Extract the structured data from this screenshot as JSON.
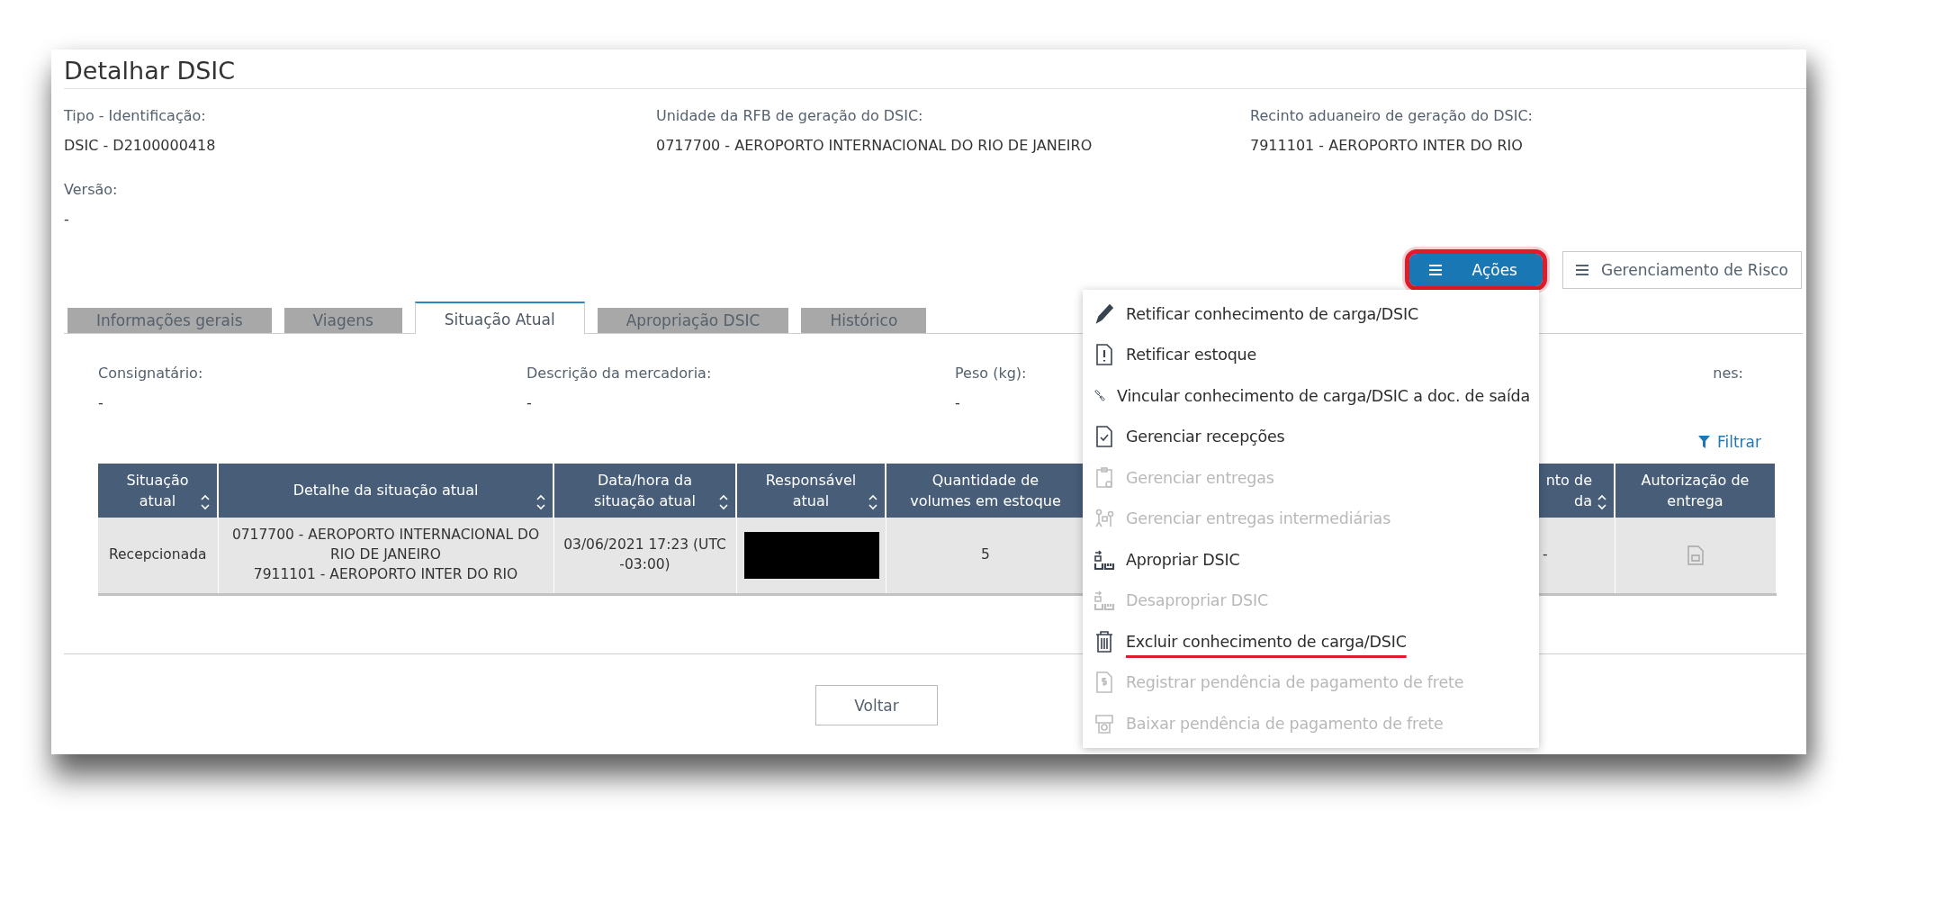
{
  "page": {
    "title": "Detalhar DSIC"
  },
  "summary_fields": [
    {
      "label": "Tipo - Identificação:",
      "value": "DSIC - D2100000418"
    },
    {
      "label": "Unidade da RFB de geração do DSIC:",
      "value": "0717700 - AEROPORTO INTERNACIONAL DO RIO DE JANEIRO"
    },
    {
      "label": "Recinto aduaneiro de geração do DSIC:",
      "value": "7911101 - AEROPORTO INTER DO RIO"
    }
  ],
  "version_field": {
    "label": "Versão:",
    "value": "-"
  },
  "actions_button": {
    "label": "Ações",
    "highlighted": true
  },
  "risk_button": {
    "label": "Gerenciamento de Risco"
  },
  "tabs": [
    {
      "label": "Informações gerais",
      "selected": false
    },
    {
      "label": "Viagens",
      "selected": false
    },
    {
      "label": "Situação Atual",
      "selected": true
    },
    {
      "label": "Apropriação DSIC",
      "selected": false
    },
    {
      "label": "Histórico",
      "selected": false
    }
  ],
  "detail_fields": [
    {
      "label": "Consignatário:",
      "value": "-"
    },
    {
      "label": "Descrição da mercadoria:",
      "value": "-"
    },
    {
      "label": "Peso (kg):",
      "value": "-"
    },
    {
      "label": "nes:"
    }
  ],
  "filter_link": {
    "label": "Filtrar"
  },
  "table": {
    "columns": [
      {
        "label": "Situação atual",
        "sortable": true
      },
      {
        "label": "Detalhe da situação atual",
        "sortable": true
      },
      {
        "label": "Data/hora da situação atual",
        "sortable": true
      },
      {
        "label": "Responsável atual",
        "sortable": true
      },
      {
        "label": "Quantidade de volumes em estoque",
        "sortable": false
      },
      {
        "label": "nto de\nda",
        "sortable": true
      },
      {
        "label": "Autorização de entrega",
        "sortable": false
      }
    ],
    "rows": [
      {
        "cells": [
          {
            "kind": "text",
            "text": "Recepcionada"
          },
          {
            "kind": "text",
            "text": "0717700 - AEROPORTO INTERNACIONAL DO RIO DE JANEIRO\n7911101 - AEROPORTO INTER DO RIO"
          },
          {
            "kind": "text",
            "text": "03/06/2021 17:23 (UTC -03:00)"
          },
          {
            "kind": "redacted"
          },
          {
            "kind": "text",
            "text": "5"
          },
          {
            "kind": "text",
            "text": "-"
          },
          {
            "kind": "icon"
          }
        ]
      }
    ]
  },
  "back_button": {
    "label": "Voltar"
  },
  "actions_menu": {
    "items": [
      {
        "label": "Retificar conhecimento de carga/DSIC",
        "disabled": false,
        "underlined": false
      },
      {
        "label": "Retificar estoque",
        "disabled": false,
        "underlined": false
      },
      {
        "label": "Vincular conhecimento de carga/DSIC a doc. de saída",
        "disabled": false,
        "underlined": false
      },
      {
        "label": "Gerenciar recepções",
        "disabled": false,
        "underlined": false
      },
      {
        "label": "Gerenciar entregas",
        "disabled": true,
        "underlined": false
      },
      {
        "label": "Gerenciar entregas intermediárias",
        "disabled": true,
        "underlined": false
      },
      {
        "label": "Apropriar DSIC",
        "disabled": false,
        "underlined": false
      },
      {
        "label": "Desapropriar DSIC",
        "disabled": true,
        "underlined": false
      },
      {
        "label": "Excluir conhecimento de carga/DSIC",
        "disabled": false,
        "underlined": true
      },
      {
        "label": "Registrar pendência de pagamento de frete",
        "disabled": true,
        "underlined": false
      },
      {
        "label": "Baixar pendência de pagamento de frete",
        "disabled": true,
        "underlined": false
      }
    ]
  }
}
